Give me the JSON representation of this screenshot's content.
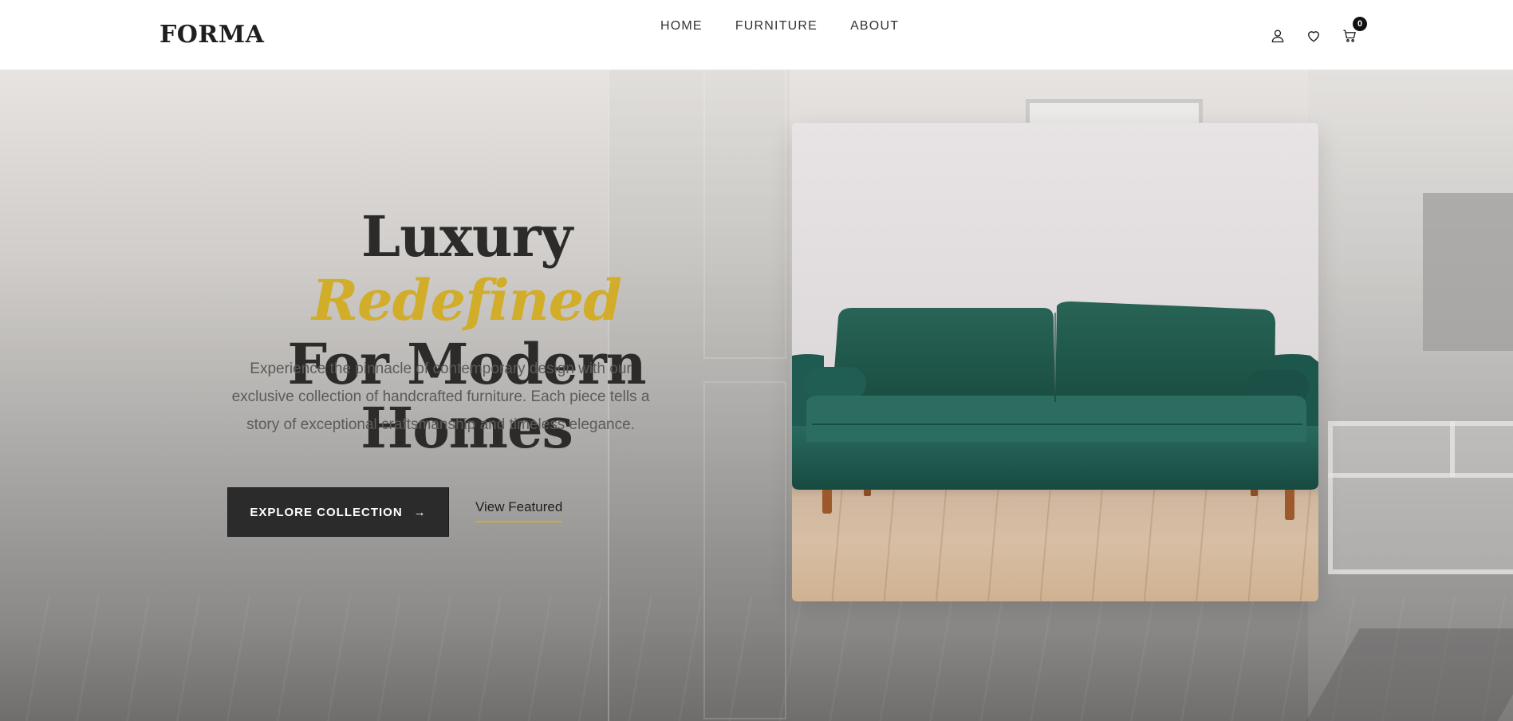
{
  "header": {
    "logo": "FORMA",
    "nav": [
      "HOME",
      "FURNITURE",
      "ABOUT"
    ],
    "icons": [
      "user-icon",
      "heart-icon",
      "cart-icon"
    ],
    "cart_count": "0"
  },
  "hero": {
    "headline_part1": "Luxury ",
    "headline_accent": "Redefined",
    "headline_line2": "For Modern Homes",
    "description": "Experience the pinnacle of contemporary design with our exclusive collection of handcrafted furniture. Each piece tells a story of exceptional craftsmanship and timeless elegance.",
    "primary_button": "EXPLORE COLLECTION",
    "primary_button_arrow": "→",
    "secondary_link": "View Featured"
  },
  "colors": {
    "accent": "#d1ad2a",
    "text_dark": "#2c2b2a",
    "button_bg": "#2b2b2b",
    "sofa": "#1f5a4f"
  }
}
